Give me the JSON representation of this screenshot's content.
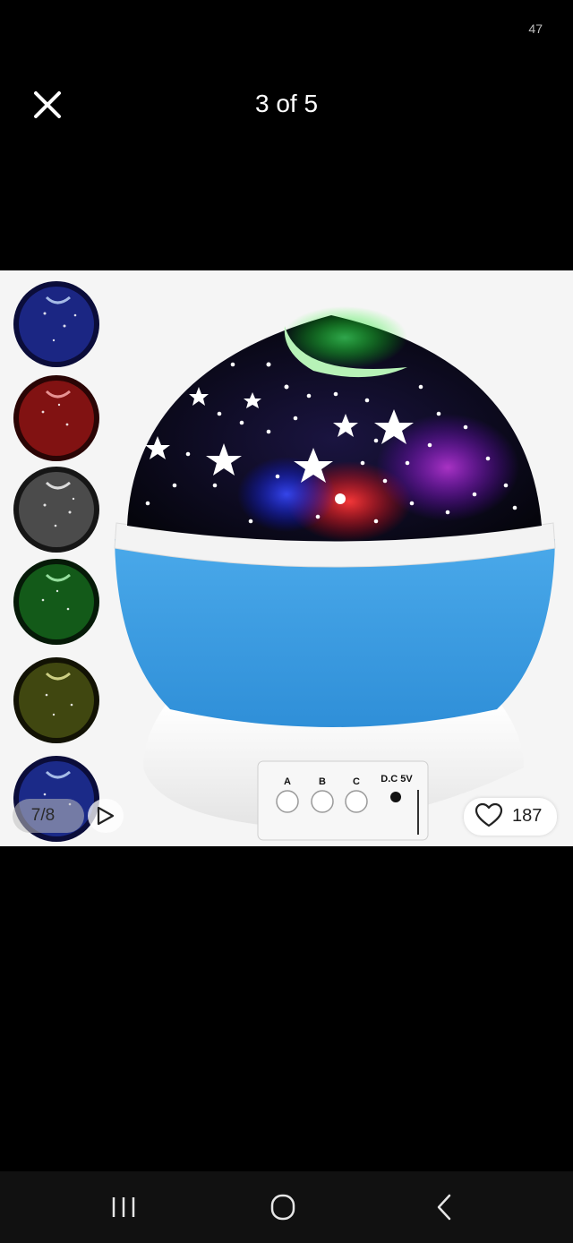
{
  "status": {
    "count": "47"
  },
  "header": {
    "title": "3 of 5",
    "close_icon": "close-icon"
  },
  "product": {
    "panel_labels": [
      "A",
      "B",
      "C",
      "D.C 5V"
    ],
    "thumbnail_colors": [
      "#2a44c8",
      "#c81e1e",
      "#cfcfcf",
      "#1f9a2a",
      "#9a9a2a",
      "#2a44c8"
    ]
  },
  "overlay": {
    "counter": "7/8",
    "play_icon": "play-icon",
    "likes": "187",
    "heart_icon": "heart-icon"
  },
  "nav": {
    "recents_icon": "recents-icon",
    "home_icon": "home-icon",
    "back_icon": "back-icon"
  },
  "colors": {
    "lamp_base": "#3a9be0",
    "background": "#000000",
    "image_bg": "#f5f5f5"
  }
}
